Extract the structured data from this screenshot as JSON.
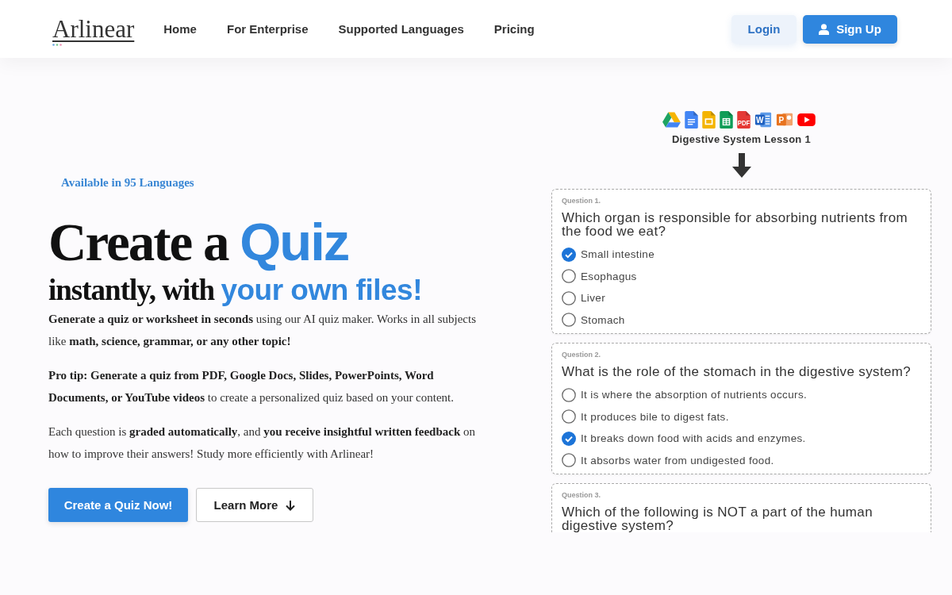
{
  "header": {
    "logo": "Arlinear",
    "nav": [
      {
        "label": "Home"
      },
      {
        "label": "For Enterprise"
      },
      {
        "label": "Supported Languages"
      },
      {
        "label": "Pricing"
      }
    ],
    "login": "Login",
    "signup": "Sign Up"
  },
  "hero": {
    "badge": "Available in 95 Languages",
    "headline": [
      {
        "text": "Create a",
        "highlight": "Quiz"
      },
      {
        "text": "instantly, with",
        "highlight": "your own files!"
      }
    ],
    "paragraphs": [
      "**Generate a quiz or worksheet in seconds** using our AI quiz maker. Works in all subjects like **math, science, grammar, or any other topic!**",
      "**Pro tip: Generate a quiz from PDF, Google Docs, Slides, PowerPoints, Word Documents, or YouTube videos** to create a personalized quiz based on your content.",
      "Each question is **graded automatically**, and **you receive insightful written feedback** on how to improve their answers! Study more efficiently with Arlinear!"
    ],
    "buttons": [
      {
        "label": "Create a Quiz Now!",
        "kind": "primary"
      },
      {
        "label": "Learn More",
        "kind": "secondary"
      }
    ]
  },
  "preview": {
    "sources": [
      {
        "kind": "drive"
      },
      {
        "kind": "docs"
      },
      {
        "kind": "slides"
      },
      {
        "kind": "sheets"
      },
      {
        "kind": "pdf",
        "label": "PDF"
      },
      {
        "kind": "word",
        "label": "W"
      },
      {
        "kind": "powerpoint",
        "label": "P"
      },
      {
        "kind": "youtube"
      }
    ],
    "title": "Digestive System Lesson 1",
    "questions": [
      {
        "label": "Question 1.",
        "text": "Which organ is responsible for absorbing nutrients from the food we eat?",
        "options": [
          {
            "text": "Small intestine",
            "selected": true
          },
          {
            "text": "Esophagus",
            "selected": false
          },
          {
            "text": "Liver",
            "selected": false
          },
          {
            "text": "Stomach",
            "selected": false
          }
        ]
      },
      {
        "label": "Question 2.",
        "text": "What is the role of the stomach in the digestive system?",
        "options": [
          {
            "text": "It is where the absorption of nutrients occurs.",
            "selected": false
          },
          {
            "text": "It produces bile to digest fats.",
            "selected": false
          },
          {
            "text": "It breaks down food with acids and enzymes.",
            "selected": true
          },
          {
            "text": "It absorbs water from undigested food.",
            "selected": false
          }
        ]
      },
      {
        "label": "Question 3.",
        "text": "Which of the following is NOT a part of the human digestive system?"
      }
    ]
  }
}
